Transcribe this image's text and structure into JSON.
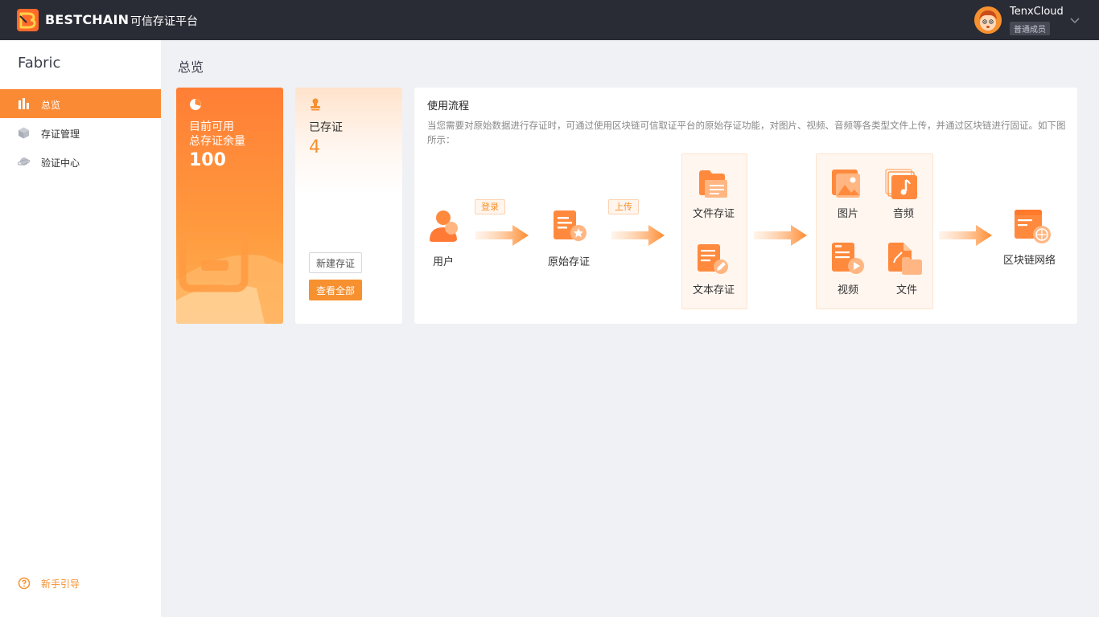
{
  "header": {
    "brand": "BESTCHAIN",
    "subtitle": "可信存证平台",
    "user_name": "TenxCloud",
    "user_role": "普通成员"
  },
  "sidebar": {
    "title": "Fabric",
    "items": [
      {
        "label": "总览",
        "icon": "bar-chart-icon",
        "active": true
      },
      {
        "label": "存证管理",
        "icon": "cube-icon",
        "active": false
      },
      {
        "label": "验证中心",
        "icon": "planet-icon",
        "active": false
      }
    ],
    "guide_label": "新手引导"
  },
  "main": {
    "page_title": "总览",
    "quota_card": {
      "line1": "目前可用",
      "line2": "总存证余量",
      "value": "100"
    },
    "stored_card": {
      "label": "已存证",
      "value": "4",
      "new_button": "新建存证",
      "view_all_button": "查看全部"
    },
    "flow": {
      "title": "使用流程",
      "description": "当您需要对原始数据进行存证时，可通过使用区块链可信取证平台的原始存证功能，对图片、视频、音频等各类型文件上传，并通过区块链进行固证。如下图所示：",
      "nodes": {
        "user": "用户",
        "login_tag": "登录",
        "raw": "原始存证",
        "upload_tag": "上传",
        "file_store": "文件存证",
        "text_store": "文本存证",
        "image": "图片",
        "audio": "音频",
        "video": "视频",
        "file": "文件",
        "blockchain": "区块链网络"
      }
    }
  },
  "colors": {
    "accent": "#f7902f",
    "topbar": "#2a2c35",
    "sidebar_active": "#fb8a35"
  }
}
